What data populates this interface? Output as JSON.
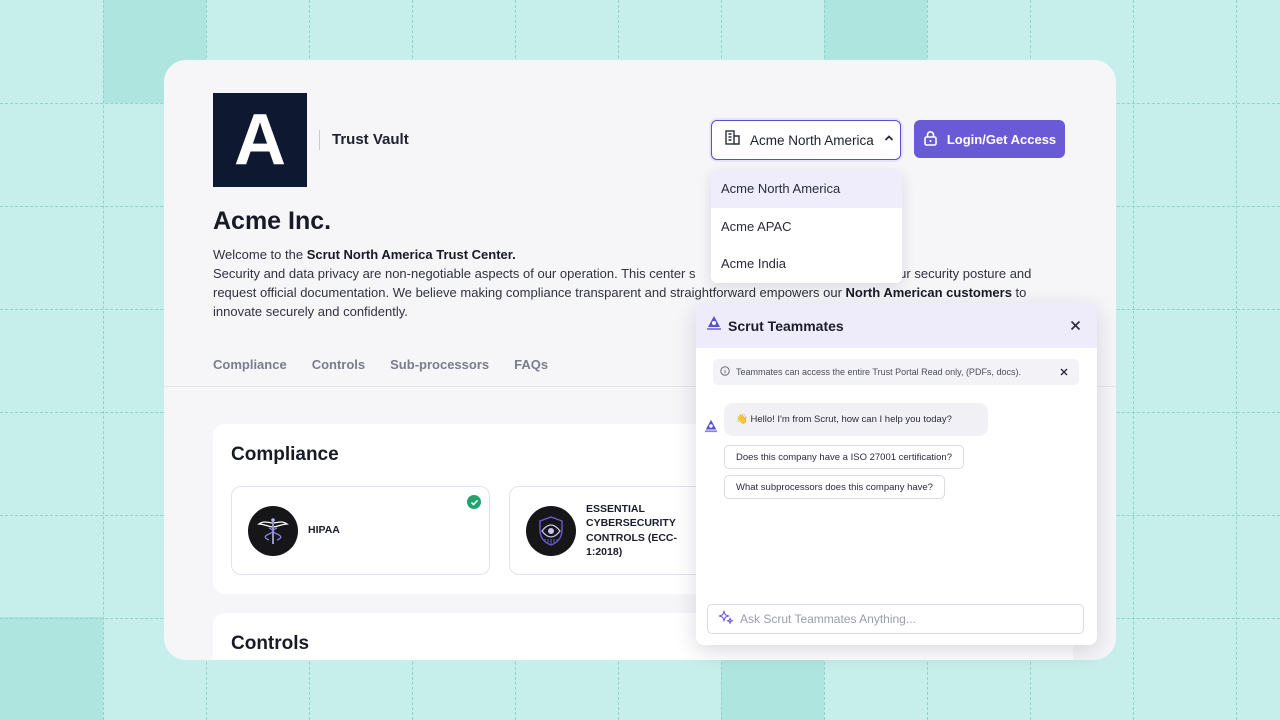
{
  "colors": {
    "background": "#c6eeea",
    "accent": "#6a5ad6",
    "logo_bg": "#0e1830",
    "success": "#22a36b"
  },
  "header": {
    "logo_letter": "A",
    "vault_title": "Trust Vault",
    "region_selected": "Acme North America",
    "login_label": "Login/Get Access",
    "icons": [
      "building-icon",
      "chevron-up-icon",
      "lock-icon"
    ]
  },
  "company": {
    "name": "Acme Inc.",
    "welcome_prefix": "Welcome to the ",
    "welcome_bold": "Scrut North America Trust Center.",
    "desc_part1": "Security and data privacy are non-negotiable aspects of our operation. This center s",
    "desc_part2": "nderstand our security posture and request official documentation. We believe making compliance transparent and straightforward empowers our ",
    "desc_bold": "North American customers",
    "desc_end": " to innovate securely and confidently."
  },
  "tabs": [
    "Compliance",
    "Controls",
    "Sub-processors",
    "FAQs"
  ],
  "compliance": {
    "title": "Compliance",
    "items": [
      {
        "name": "HIPAA",
        "icon": "caduceus-icon",
        "verified": true
      },
      {
        "name": "ESSENTIAL CYBERSECURITY CONTROLS (ECC-1:2018)",
        "icon": "eye-shield-icon",
        "verified": false
      }
    ]
  },
  "controls": {
    "title": "Controls"
  },
  "region_dropdown": {
    "options": [
      "Acme North America",
      "Acme APAC",
      "Acme India"
    ],
    "selected_index": 0
  },
  "chat": {
    "title": "Scrut Teammates",
    "notice": "Teammates can access the entire Trust Portal Read only, (PDFs, docs).",
    "greeting": "👋 Hello! I'm from Scrut, how can I help you today?",
    "suggestions": [
      "Does this company have a ISO 27001 certification?",
      "What subprocessors does this company have?"
    ],
    "input_placeholder": "Ask Scrut Teammates Anything..."
  }
}
